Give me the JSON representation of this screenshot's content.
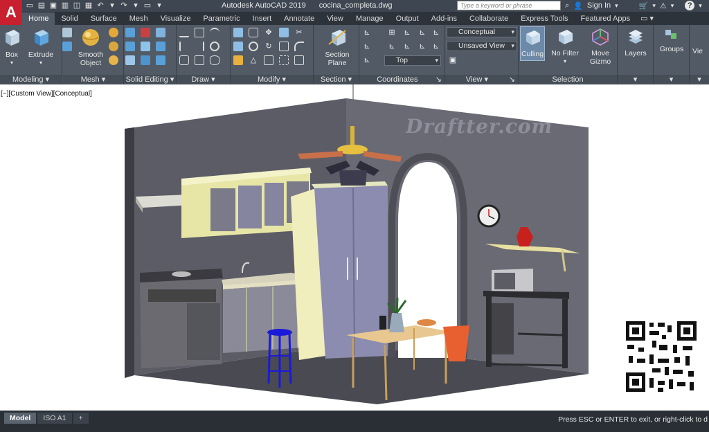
{
  "titlebar": {
    "app_name": "Autodesk AutoCAD 2019",
    "file_name": "cocina_completa.dwg",
    "search_placeholder": "Type a keyword or phrase",
    "sign_in": "Sign In",
    "help": "?"
  },
  "tabs": [
    "Home",
    "Solid",
    "Surface",
    "Mesh",
    "Visualize",
    "Parametric",
    "Insert",
    "Annotate",
    "View",
    "Manage",
    "Output",
    "Add-ins",
    "Collaborate",
    "Express Tools",
    "Featured Apps"
  ],
  "ribbon": {
    "modeling": {
      "title": "Modeling",
      "box": "Box",
      "extrude": "Extrude"
    },
    "mesh": {
      "title": "Mesh",
      "smooth_object": "Smooth Object"
    },
    "solid_editing": {
      "title": "Solid Editing"
    },
    "draw": {
      "title": "Draw"
    },
    "modify": {
      "title": "Modify"
    },
    "section": {
      "title": "Section",
      "section_plane": "Section Plane"
    },
    "coordinates": {
      "title": "Coordinates"
    },
    "view": {
      "title": "View",
      "visual_style": "Conceptual",
      "named_view": "Unsaved View",
      "view_direction": "Top"
    },
    "selection": {
      "title": "Selection",
      "culling": "Culling",
      "no_filter": "No Filter",
      "move_gizmo": "Move Gizmo"
    },
    "layers": {
      "title": "Layers"
    },
    "groups": {
      "title": "Groups"
    },
    "view_btn": {
      "title": "Vie"
    }
  },
  "viewport": {
    "label": "[−][Custom View][Conceptual]",
    "watermark": "Draftter.com"
  },
  "statusbar": {
    "layout_tabs": [
      "Model",
      "ISO A1",
      "+"
    ],
    "message": "Press ESC or ENTER to exit, or right-click to d"
  }
}
